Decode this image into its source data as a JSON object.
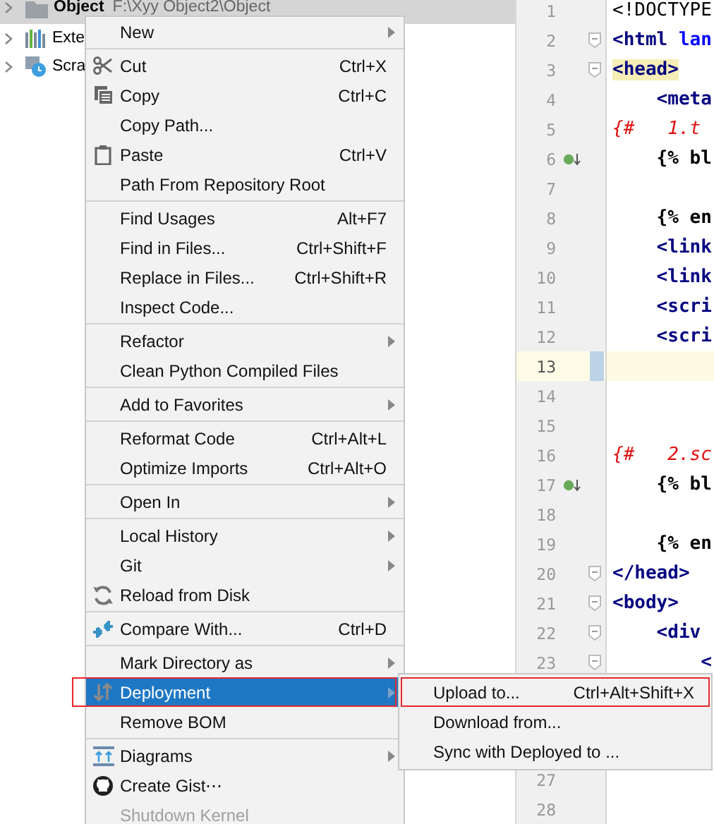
{
  "project_tree": {
    "items": [
      {
        "name": "Object",
        "path": "F:\\Xyy Object2\\Object",
        "selected": true
      },
      {
        "name": "Exte",
        "selected": false
      },
      {
        "name": "Scra",
        "selected": false
      }
    ]
  },
  "editor": {
    "lines": [
      {
        "number": "1",
        "kind": "plain",
        "segments": [
          {
            "kind": "plain",
            "text": "<!DOCTYPE"
          }
        ]
      },
      {
        "number": "2",
        "kind": "fold",
        "segments": [
          {
            "kind": "tag",
            "text": "<html"
          },
          {
            "kind": "attr",
            "text": " lan"
          }
        ]
      },
      {
        "number": "3",
        "kind": "fold",
        "segments": [
          {
            "kind": "tag-match",
            "text": "<head>"
          }
        ]
      },
      {
        "number": "4",
        "kind": "plain",
        "segments": [
          {
            "kind": "tag",
            "text": "    <meta"
          }
        ]
      },
      {
        "number": "5",
        "kind": "plain",
        "segments": [
          {
            "kind": "comment",
            "text": "{#   1.t"
          }
        ]
      },
      {
        "number": "6",
        "kind": "implements",
        "segments": [
          {
            "kind": "template",
            "text": "    {% bl"
          }
        ]
      },
      {
        "number": "7",
        "kind": "plain"
      },
      {
        "number": "8",
        "kind": "plain",
        "segments": [
          {
            "kind": "template",
            "text": "    {% en"
          }
        ]
      },
      {
        "number": "9",
        "kind": "plain",
        "segments": [
          {
            "kind": "tag",
            "text": "    <link"
          }
        ]
      },
      {
        "number": "10",
        "kind": "plain",
        "segments": [
          {
            "kind": "tag",
            "text": "    <link"
          }
        ]
      },
      {
        "number": "11",
        "kind": "plain",
        "segments": [
          {
            "kind": "tag",
            "text": "    <scri"
          }
        ]
      },
      {
        "number": "12",
        "kind": "plain",
        "segments": [
          {
            "kind": "tag",
            "text": "    <scri"
          }
        ]
      },
      {
        "number": "13",
        "kind": "plain",
        "current": true
      },
      {
        "number": "14",
        "kind": "plain"
      },
      {
        "number": "15",
        "kind": "plain"
      },
      {
        "number": "16",
        "kind": "plain",
        "segments": [
          {
            "kind": "comment",
            "text": "{#   2.sc"
          }
        ]
      },
      {
        "number": "17",
        "kind": "implements",
        "segments": [
          {
            "kind": "template",
            "text": "    {% bl"
          }
        ]
      },
      {
        "number": "18",
        "kind": "plain"
      },
      {
        "number": "19",
        "kind": "plain",
        "segments": [
          {
            "kind": "template",
            "text": "    {% en"
          }
        ]
      },
      {
        "number": "20",
        "kind": "fold",
        "segments": [
          {
            "kind": "tag",
            "text": "</head>"
          }
        ]
      },
      {
        "number": "21",
        "kind": "fold",
        "segments": [
          {
            "kind": "tag",
            "text": "<body>"
          }
        ]
      },
      {
        "number": "22",
        "kind": "fold",
        "segments": [
          {
            "kind": "tag",
            "text": "    <div"
          }
        ]
      },
      {
        "number": "23",
        "kind": "fold",
        "segments": [
          {
            "kind": "tag",
            "text": "        <"
          }
        ]
      }
    ],
    "lines_below": [
      {
        "number": "27"
      },
      {
        "number": "28"
      }
    ]
  },
  "context_menu": {
    "groups": [
      {
        "items": [
          {
            "label": "New",
            "kind": "submenu",
            "selected": false,
            "disabled": false
          }
        ]
      },
      {
        "items": [
          {
            "label": "Cut",
            "kind": "action",
            "shortcut": "Ctrl+X",
            "selected": false,
            "disabled": false
          },
          {
            "label": "Copy",
            "kind": "action",
            "shortcut": "Ctrl+C",
            "selected": false,
            "disabled": false
          },
          {
            "label": "Copy Path...",
            "kind": "action",
            "selected": false,
            "disabled": false
          },
          {
            "label": "Paste",
            "kind": "action",
            "shortcut": "Ctrl+V",
            "selected": false,
            "disabled": false
          },
          {
            "label": "Path From Repository Root",
            "kind": "action",
            "selected": false,
            "disabled": false
          }
        ]
      },
      {
        "items": [
          {
            "label": "Find Usages",
            "kind": "action",
            "shortcut": "Alt+F7",
            "selected": false,
            "disabled": false
          },
          {
            "label": "Find in Files...",
            "kind": "action",
            "shortcut": "Ctrl+Shift+F",
            "selected": false,
            "disabled": false
          },
          {
            "label": "Replace in Files...",
            "kind": "action",
            "shortcut": "Ctrl+Shift+R",
            "selected": false,
            "disabled": false
          },
          {
            "label": "Inspect Code...",
            "kind": "action",
            "selected": false,
            "disabled": false
          }
        ]
      },
      {
        "items": [
          {
            "label": "Refactor",
            "kind": "submenu",
            "selected": false,
            "disabled": false
          },
          {
            "label": "Clean Python Compiled Files",
            "kind": "action",
            "selected": false,
            "disabled": false
          }
        ]
      },
      {
        "items": [
          {
            "label": "Add to Favorites",
            "kind": "submenu",
            "selected": false,
            "disabled": false
          }
        ]
      },
      {
        "items": [
          {
            "label": "Reformat Code",
            "kind": "action",
            "shortcut": "Ctrl+Alt+L",
            "selected": false,
            "disabled": false
          },
          {
            "label": "Optimize Imports",
            "kind": "action",
            "shortcut": "Ctrl+Alt+O",
            "selected": false,
            "disabled": false
          }
        ]
      },
      {
        "items": [
          {
            "label": "Open In",
            "kind": "submenu",
            "selected": false,
            "disabled": false
          }
        ]
      },
      {
        "items": [
          {
            "label": "Local History",
            "kind": "submenu",
            "selected": false,
            "disabled": false
          },
          {
            "label": "Git",
            "kind": "submenu",
            "selected": false,
            "disabled": false
          },
          {
            "label": "Reload from Disk",
            "kind": "action",
            "selected": false,
            "disabled": false
          }
        ]
      },
      {
        "items": [
          {
            "label": "Compare With...",
            "kind": "action",
            "shortcut": "Ctrl+D",
            "selected": false,
            "disabled": false
          }
        ]
      },
      {
        "items": [
          {
            "label": "Mark Directory as",
            "kind": "submenu",
            "selected": false,
            "disabled": false
          },
          {
            "label": "Deployment",
            "kind": "submenu",
            "selected": true,
            "disabled": false,
            "marked": true
          },
          {
            "label": "Remove BOM",
            "kind": "action",
            "selected": false,
            "disabled": false
          }
        ]
      },
      {
        "items": [
          {
            "label": "Diagrams",
            "kind": "submenu",
            "selected": false,
            "disabled": false
          },
          {
            "label": "Create Gist⋯",
            "kind": "action",
            "selected": false,
            "disabled": false
          },
          {
            "label": "Shutdown Kernel",
            "kind": "action",
            "selected": false,
            "disabled": true
          }
        ]
      }
    ]
  },
  "submenu": {
    "items": [
      {
        "label": "Upload to...",
        "shortcut": "Ctrl+Alt+Shift+X",
        "marked": true
      },
      {
        "label": "Download from...",
        "marked": false
      },
      {
        "label": "Sync with Deployed to ...",
        "marked": false
      }
    ]
  }
}
